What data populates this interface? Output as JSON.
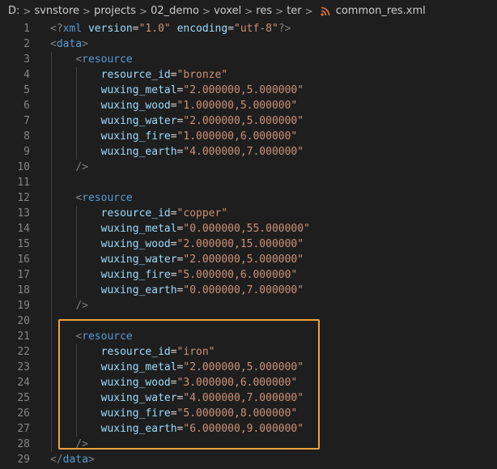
{
  "breadcrumb": {
    "segments": [
      "D:",
      "svnstore",
      "projects",
      "02_demo",
      "voxel",
      "res",
      "ter"
    ],
    "file_icon": "rss-icon",
    "file_name": "common_res.xml"
  },
  "editor": {
    "lines": [
      {
        "n": "1",
        "tokens": [
          [
            "punct",
            "<?"
          ],
          [
            "tag",
            "xml"
          ],
          [
            "eq",
            " "
          ],
          [
            "attr",
            "version"
          ],
          [
            "eq",
            "="
          ],
          [
            "str",
            "\"1.0\""
          ],
          [
            "eq",
            " "
          ],
          [
            "attr",
            "encoding"
          ],
          [
            "eq",
            "="
          ],
          [
            "str",
            "\"utf-8\""
          ],
          [
            "punct",
            "?>"
          ]
        ]
      },
      {
        "n": "2",
        "tokens": [
          [
            "punct",
            "<"
          ],
          [
            "tag",
            "data"
          ],
          [
            "punct",
            ">"
          ]
        ]
      },
      {
        "n": "3",
        "tokens": [
          [
            "eq",
            "    "
          ],
          [
            "punct",
            "<"
          ],
          [
            "tag",
            "resource"
          ]
        ]
      },
      {
        "n": "4",
        "tokens": [
          [
            "eq",
            "        "
          ],
          [
            "attr",
            "resource_id"
          ],
          [
            "eq",
            "="
          ],
          [
            "str",
            "\"bronze\""
          ]
        ]
      },
      {
        "n": "5",
        "tokens": [
          [
            "eq",
            "        "
          ],
          [
            "attr",
            "wuxing_metal"
          ],
          [
            "eq",
            "="
          ],
          [
            "str",
            "\"2.000000,5.000000\""
          ]
        ]
      },
      {
        "n": "6",
        "tokens": [
          [
            "eq",
            "        "
          ],
          [
            "attr",
            "wuxing_wood"
          ],
          [
            "eq",
            "="
          ],
          [
            "str",
            "\"1.000000,5.000000\""
          ]
        ]
      },
      {
        "n": "7",
        "tokens": [
          [
            "eq",
            "        "
          ],
          [
            "attr",
            "wuxing_water"
          ],
          [
            "eq",
            "="
          ],
          [
            "str",
            "\"2.000000,5.000000\""
          ]
        ]
      },
      {
        "n": "8",
        "tokens": [
          [
            "eq",
            "        "
          ],
          [
            "attr",
            "wuxing_fire"
          ],
          [
            "eq",
            "="
          ],
          [
            "str",
            "\"1.000000,6.000000\""
          ]
        ]
      },
      {
        "n": "9",
        "tokens": [
          [
            "eq",
            "        "
          ],
          [
            "attr",
            "wuxing_earth"
          ],
          [
            "eq",
            "="
          ],
          [
            "str",
            "\"4.000000,7.000000\""
          ]
        ]
      },
      {
        "n": "10",
        "tokens": [
          [
            "eq",
            "    "
          ],
          [
            "punct",
            "/>"
          ]
        ]
      },
      {
        "n": "11",
        "tokens": []
      },
      {
        "n": "12",
        "tokens": [
          [
            "eq",
            "    "
          ],
          [
            "punct",
            "<"
          ],
          [
            "tag",
            "resource"
          ]
        ]
      },
      {
        "n": "13",
        "tokens": [
          [
            "eq",
            "        "
          ],
          [
            "attr",
            "resource_id"
          ],
          [
            "eq",
            "="
          ],
          [
            "str",
            "\"copper\""
          ]
        ]
      },
      {
        "n": "14",
        "tokens": [
          [
            "eq",
            "        "
          ],
          [
            "attr",
            "wuxing_metal"
          ],
          [
            "eq",
            "="
          ],
          [
            "str",
            "\"0.000000,55.000000\""
          ]
        ]
      },
      {
        "n": "15",
        "tokens": [
          [
            "eq",
            "        "
          ],
          [
            "attr",
            "wuxing_wood"
          ],
          [
            "eq",
            "="
          ],
          [
            "str",
            "\"2.000000,15.000000\""
          ]
        ]
      },
      {
        "n": "16",
        "tokens": [
          [
            "eq",
            "        "
          ],
          [
            "attr",
            "wuxing_water"
          ],
          [
            "eq",
            "="
          ],
          [
            "str",
            "\"2.000000,5.000000\""
          ]
        ]
      },
      {
        "n": "17",
        "tokens": [
          [
            "eq",
            "        "
          ],
          [
            "attr",
            "wuxing_fire"
          ],
          [
            "eq",
            "="
          ],
          [
            "str",
            "\"5.000000,6.000000\""
          ]
        ]
      },
      {
        "n": "18",
        "tokens": [
          [
            "eq",
            "        "
          ],
          [
            "attr",
            "wuxing_earth"
          ],
          [
            "eq",
            "="
          ],
          [
            "str",
            "\"0.000000,7.000000\""
          ]
        ]
      },
      {
        "n": "19",
        "tokens": [
          [
            "eq",
            "    "
          ],
          [
            "punct",
            "/>"
          ]
        ]
      },
      {
        "n": "20",
        "tokens": []
      },
      {
        "n": "21",
        "tokens": [
          [
            "eq",
            "    "
          ],
          [
            "punct",
            "<"
          ],
          [
            "tag",
            "resource"
          ]
        ]
      },
      {
        "n": "22",
        "tokens": [
          [
            "eq",
            "        "
          ],
          [
            "attr",
            "resource_id"
          ],
          [
            "eq",
            "="
          ],
          [
            "str",
            "\"iron\""
          ]
        ]
      },
      {
        "n": "23",
        "tokens": [
          [
            "eq",
            "        "
          ],
          [
            "attr",
            "wuxing_metal"
          ],
          [
            "eq",
            "="
          ],
          [
            "str",
            "\"2.000000,5.000000\""
          ]
        ]
      },
      {
        "n": "24",
        "tokens": [
          [
            "eq",
            "        "
          ],
          [
            "attr",
            "wuxing_wood"
          ],
          [
            "eq",
            "="
          ],
          [
            "str",
            "\"3.000000,6.000000\""
          ]
        ]
      },
      {
        "n": "25",
        "tokens": [
          [
            "eq",
            "        "
          ],
          [
            "attr",
            "wuxing_water"
          ],
          [
            "eq",
            "="
          ],
          [
            "str",
            "\"4.000000,7.000000\""
          ]
        ]
      },
      {
        "n": "26",
        "tokens": [
          [
            "eq",
            "        "
          ],
          [
            "attr",
            "wuxing_fire"
          ],
          [
            "eq",
            "="
          ],
          [
            "str",
            "\"5.000000,8.000000\""
          ]
        ]
      },
      {
        "n": "27",
        "tokens": [
          [
            "eq",
            "        "
          ],
          [
            "attr",
            "wuxing_earth"
          ],
          [
            "eq",
            "="
          ],
          [
            "str",
            "\"6.000000,9.000000\""
          ]
        ]
      },
      {
        "n": "28",
        "tokens": [
          [
            "eq",
            "    "
          ],
          [
            "punct",
            "/>"
          ]
        ]
      },
      {
        "n": "29",
        "tokens": [
          [
            "punct",
            "</"
          ],
          [
            "tag",
            "data"
          ],
          [
            "punct",
            ">"
          ]
        ]
      }
    ]
  },
  "colors": {
    "background": "#1e1e1e",
    "tag": "#569cd6",
    "attribute": "#9cdcfe",
    "string": "#ce9178",
    "line_number": "#858585",
    "highlight_border": "#f0a040",
    "file_icon": "#e37933"
  }
}
